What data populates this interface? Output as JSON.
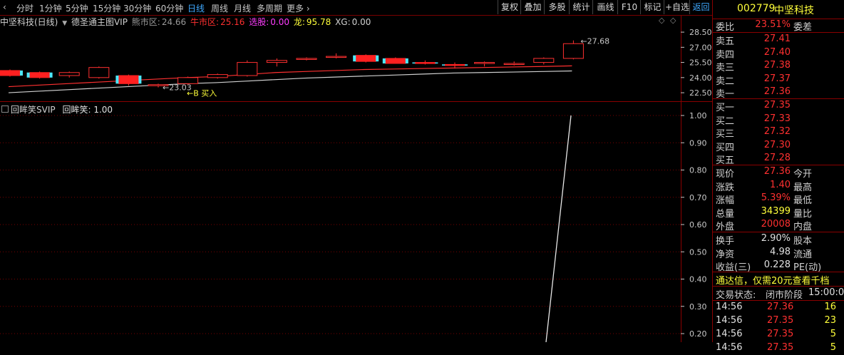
{
  "toolbar": {
    "periods": [
      "分时",
      "1分钟",
      "5分钟",
      "15分钟",
      "30分钟",
      "60分钟",
      "日线",
      "周线",
      "月线",
      "多周期",
      "更多"
    ],
    "active_period": "日线",
    "right_buttons": [
      "复权",
      "叠加",
      "多股",
      "统计",
      "画线",
      "F10",
      "标记",
      "+自选",
      "返回"
    ]
  },
  "indicator_line": {
    "title": "中坚科技(日线)",
    "main_name": "德圣通主图VIP",
    "bear_label": "熊市区:",
    "bear_value": "24.66",
    "bull_label": "牛市区:",
    "bull_value": "25.16",
    "select_label": "选股:",
    "select_value": "0.00",
    "dragon_label": "龙:",
    "dragon_value": "95.78",
    "xg_label": "XG:",
    "xg_value": "0.00"
  },
  "main_chart": {
    "price_axis": [
      "28.50",
      "27.00",
      "25.50",
      "24.00",
      "22.50"
    ],
    "annotations": {
      "high": "27.68",
      "low": "23.03",
      "buy": "B 买入"
    }
  },
  "sub_chart": {
    "header": "回眸笑SVIP",
    "value_label": "回眸笑:",
    "value": "1.00",
    "axis": [
      "1.00",
      "0.90",
      "0.80",
      "0.70",
      "0.60",
      "0.50",
      "0.40",
      "0.30",
      "0.20"
    ]
  },
  "chart_data": {
    "type": "line",
    "title": "",
    "x": [
      0,
      1
    ],
    "series": [
      {
        "name": "回眸笑",
        "values": [
          0.0,
          1.0
        ]
      }
    ],
    "ylim": [
      0.15,
      1.05
    ],
    "candles": [
      {
        "open": 24.7,
        "close": 24.2,
        "high": 24.8,
        "low": 24.1
      },
      {
        "open": 24.5,
        "close": 24.0,
        "high": 24.6,
        "low": 23.9
      },
      {
        "open": 24.2,
        "close": 24.5,
        "high": 24.6,
        "low": 24.0
      },
      {
        "open": 24.0,
        "close": 25.0,
        "high": 25.1,
        "low": 23.9
      },
      {
        "open": 24.2,
        "close": 23.4,
        "high": 24.3,
        "low": 23.2
      },
      {
        "open": 23.3,
        "close": 23.3,
        "high": 23.4,
        "low": 23.03
      },
      {
        "open": 23.4,
        "close": 24.0,
        "high": 24.1,
        "low": 23.3
      },
      {
        "open": 24.0,
        "close": 24.3,
        "high": 24.4,
        "low": 23.9
      },
      {
        "open": 24.2,
        "close": 25.5,
        "high": 25.7,
        "low": 24.1
      },
      {
        "open": 25.5,
        "close": 25.7,
        "high": 25.9,
        "low": 25.1
      },
      {
        "open": 25.8,
        "close": 25.9,
        "high": 26.0,
        "low": 25.7
      },
      {
        "open": 26.0,
        "close": 26.1,
        "high": 26.4,
        "low": 25.9
      },
      {
        "open": 26.2,
        "close": 25.6,
        "high": 26.3,
        "low": 25.5
      },
      {
        "open": 25.9,
        "close": 25.4,
        "high": 26.0,
        "low": 25.4
      },
      {
        "open": 25.5,
        "close": 25.4,
        "high": 25.7,
        "low": 25.3
      },
      {
        "open": 25.3,
        "close": 25.2,
        "high": 25.5,
        "low": 24.9
      },
      {
        "open": 25.4,
        "close": 25.5,
        "high": 25.6,
        "low": 25.1
      },
      {
        "open": 25.4,
        "close": 25.4,
        "high": 25.6,
        "low": 25.2
      },
      {
        "open": 25.5,
        "close": 25.9,
        "high": 26.0,
        "low": 25.3
      },
      {
        "open": 25.9,
        "close": 27.36,
        "high": 27.68,
        "low": 25.8
      }
    ],
    "ma_upper": [
      23.1,
      23.25,
      23.4,
      23.55,
      23.7,
      23.85,
      24.0,
      24.1,
      24.3,
      24.5,
      24.6,
      24.7,
      24.8,
      24.85,
      24.9,
      24.95,
      25.0,
      25.05,
      25.1,
      25.16
    ],
    "ma_lower": [
      22.5,
      22.65,
      22.8,
      22.95,
      23.1,
      23.25,
      23.4,
      23.5,
      23.65,
      23.8,
      23.95,
      24.05,
      24.15,
      24.25,
      24.35,
      24.45,
      24.5,
      24.55,
      24.6,
      24.66
    ]
  },
  "quote": {
    "code": "002779",
    "name": "中坚科技",
    "webi_label": "委比",
    "webi_value": "23.51%",
    "weicha_label": "委差",
    "sells": [
      {
        "label": "卖五",
        "price": "27.41"
      },
      {
        "label": "卖四",
        "price": "27.40"
      },
      {
        "label": "卖三",
        "price": "27.38"
      },
      {
        "label": "卖二",
        "price": "27.37"
      },
      {
        "label": "卖一",
        "price": "27.36"
      }
    ],
    "buys": [
      {
        "label": "买一",
        "price": "27.35"
      },
      {
        "label": "买二",
        "price": "27.33"
      },
      {
        "label": "买三",
        "price": "27.32"
      },
      {
        "label": "买四",
        "price": "27.30"
      },
      {
        "label": "买五",
        "price": "27.28"
      }
    ],
    "stats": [
      {
        "label": "现价",
        "value": "27.36",
        "label2": "今开"
      },
      {
        "label": "涨跌",
        "value": "1.40",
        "label2": "最高"
      },
      {
        "label": "涨幅",
        "value": "5.39%",
        "label2": "最低"
      },
      {
        "label": "总量",
        "value": "34399",
        "label2": "量比"
      },
      {
        "label": "外盘",
        "value": "20008",
        "label2": "内盘"
      }
    ],
    "stats2": [
      {
        "label": "换手",
        "value": "2.90%",
        "label2": "股本"
      },
      {
        "label": "净资",
        "value": "4.98",
        "label2": "流通"
      },
      {
        "label": "收益(三)",
        "value": "0.228",
        "label2": "PE(动)"
      }
    ],
    "promo": "通达信，仅需20元查看千档",
    "trade_status_label": "交易状态:",
    "trade_status_value": "闭市阶段",
    "trade_status_time": "15:00:0",
    "ticks": [
      {
        "time": "14:56",
        "price": "27.36",
        "vol": "16"
      },
      {
        "time": "14:56",
        "price": "27.35",
        "vol": "23"
      },
      {
        "time": "14:56",
        "price": "27.35",
        "vol": "5"
      },
      {
        "time": "14:56",
        "price": "27.35",
        "vol": "5"
      }
    ]
  }
}
